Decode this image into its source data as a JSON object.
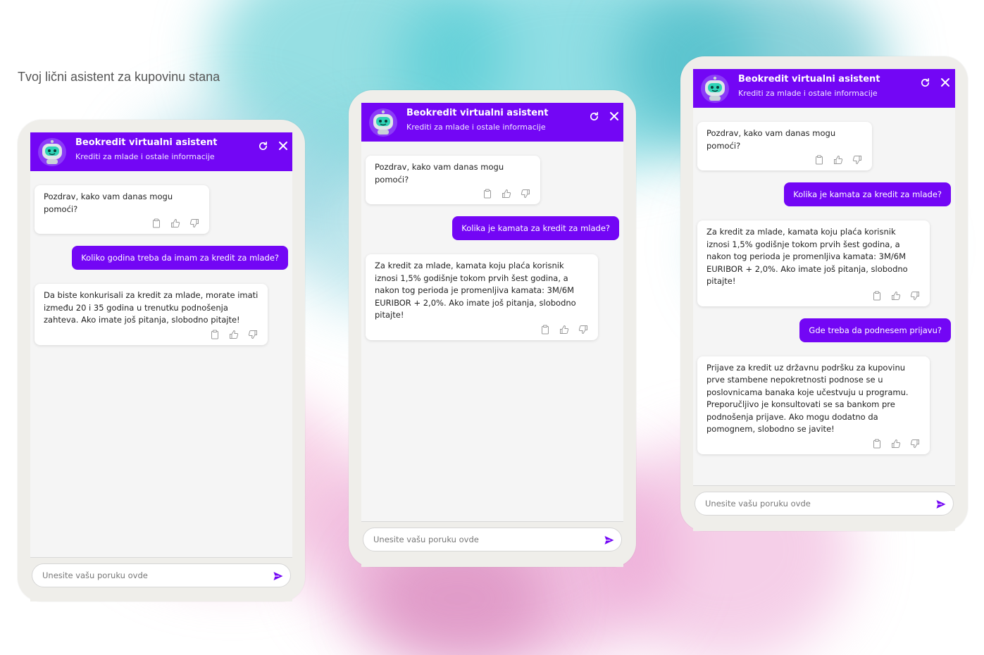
{
  "page": {
    "tagline": "Tvoj lični asistent za kupovinu stana"
  },
  "colors": {
    "brand": "#7306f5",
    "frame": "#efeeea",
    "chat_bg": "#f5f5f5"
  },
  "icons": {
    "header": [
      "robot-avatar-icon",
      "refresh-icon",
      "close-icon"
    ],
    "message_actions": [
      "clipboard-icon",
      "thumbs-up-icon",
      "thumbs-down-icon"
    ],
    "input": "send-icon"
  },
  "chat1": {
    "title": "Beokredit virtualni asistent",
    "subtitle": "Krediti za mlade i ostale informacije",
    "greeting": "Pozdrav, kako vam danas mogu pomoći?",
    "q1": "Koliko godina treba da imam za kredit za mlade?",
    "a1": "Da biste konkurisali za kredit za mlade, morate imati između 20 i 35 godina u trenutku podnošenja zahteva. Ako imate još pitanja, slobodno pitajte!",
    "placeholder": "Unesite vašu poruku ovde"
  },
  "chat2": {
    "title": "Beokredit virtualni asistent",
    "subtitle": "Krediti za mlade i ostale informacije",
    "greeting": "Pozdrav, kako vam danas mogu pomoći?",
    "q1": "Kolika je kamata za kredit za mlade?",
    "a1": "Za kredit za mlade, kamata koju plaća korisnik iznosi 1,5% godišnje tokom prvih šest godina, a nakon tog perioda je promenljiva kamata: 3M/6M EURIBOR + 2,0%. Ako imate još pitanja, slobodno pitajte!",
    "placeholder": "Unesite vašu poruku ovde"
  },
  "chat3": {
    "title": "Beokredit virtualni asistent",
    "subtitle": "Krediti za mlade i ostale informacije",
    "greeting": "Pozdrav, kako vam danas mogu pomoći?",
    "q1": "Kolika je kamata za kredit za mlade?",
    "a1": "Za kredit za mlade, kamata koju plaća korisnik iznosi 1,5% godišnje tokom prvih šest godina, a nakon tog perioda je promenljiva kamata: 3M/6M EURIBOR + 2,0%. Ako imate još pitanja, slobodno pitajte!",
    "q2": "Gde treba da podnesem prijavu?",
    "a2": "Prijave za kredit uz državnu podršku za kupovinu prve stambene nepokretnosti podnose se u poslovnicama banaka koje učestvuju u programu. Preporučljivo je konsultovati se sa bankom pre podnošenja prijave. Ako mogu dodatno da pomognem, slobodno se javite!",
    "placeholder": "Unesite vašu poruku ovde"
  }
}
